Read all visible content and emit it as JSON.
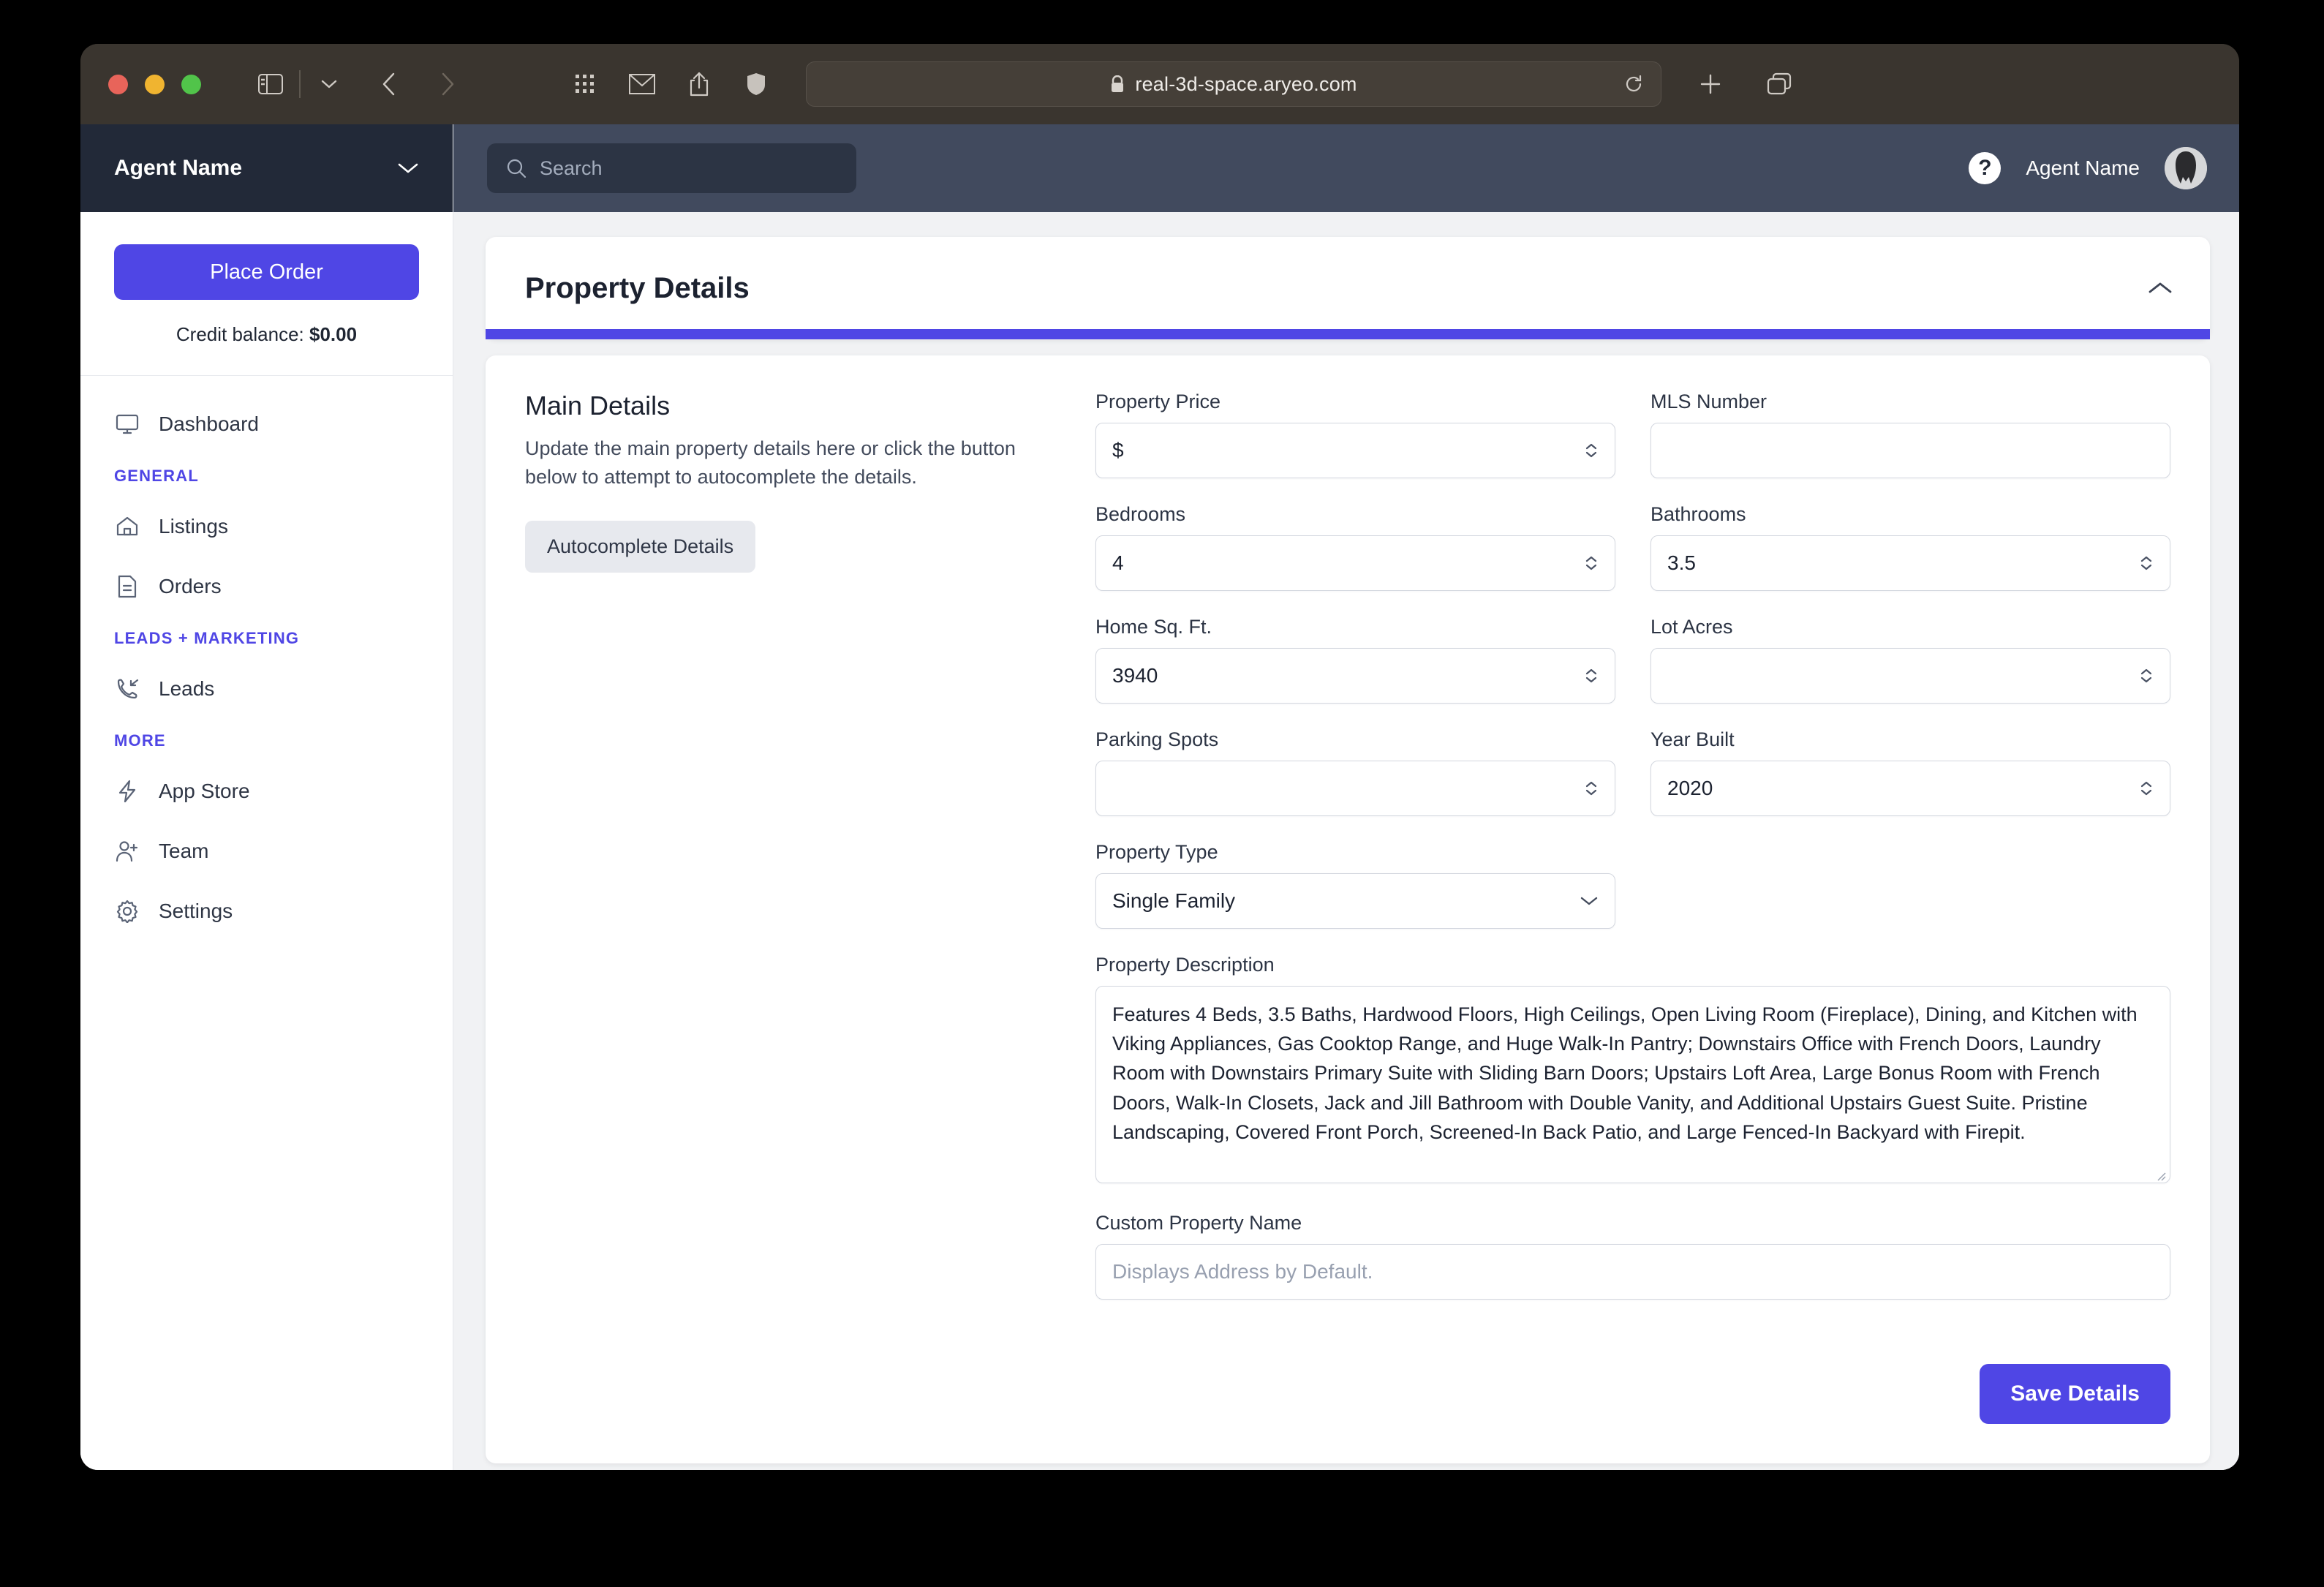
{
  "browser": {
    "url": "real-3d-space.aryeo.com",
    "icons": {
      "sidebar_toggle": "sidebar-toggle-icon",
      "sidebar_dropdown": "chevron-down-icon",
      "back": "back-arrow-icon",
      "forward": "forward-arrow-icon",
      "apps_grid": "apps-grid-icon",
      "mail": "mail-icon",
      "share": "share-icon",
      "privacy_shield": "shield-icon",
      "lock": "lock-icon",
      "reload": "reload-icon",
      "new_tab": "plus-icon",
      "tab_overview": "tab-overview-icon"
    }
  },
  "sidebar": {
    "org_name": "Agent Name",
    "org_caret": "chevron-down-icon",
    "place_order_label": "Place Order",
    "credit_label": "Credit balance:",
    "credit_value": "$0.00",
    "items": [
      {
        "label": "Dashboard",
        "icon": "monitor-icon"
      }
    ],
    "sections": [
      {
        "title": "GENERAL",
        "items": [
          {
            "label": "Listings",
            "icon": "home-icon"
          },
          {
            "label": "Orders",
            "icon": "document-icon"
          }
        ]
      },
      {
        "title": "LEADS + MARKETING",
        "items": [
          {
            "label": "Leads",
            "icon": "phone-incoming-icon"
          }
        ]
      },
      {
        "title": "MORE",
        "items": [
          {
            "label": "App Store",
            "icon": "lightning-icon"
          },
          {
            "label": "Team",
            "icon": "user-plus-icon"
          },
          {
            "label": "Settings",
            "icon": "gear-icon"
          }
        ]
      }
    ]
  },
  "topbar": {
    "search_placeholder": "Search",
    "search_value": "",
    "search_icon": "search-icon",
    "help_label": "?",
    "user_name": "Agent Name",
    "avatar_icon": "avatar"
  },
  "card": {
    "title": "Property Details",
    "collapse_icon": "chevron-up-icon",
    "accent_color": "#4f46e5"
  },
  "main_details": {
    "heading": "Main Details",
    "description": "Update the main property details here or click the button below to attempt to autocomplete the details.",
    "autocomplete_label": "Autocomplete Details"
  },
  "form": {
    "property_price": {
      "label": "Property Price",
      "value": "$",
      "spinner": true
    },
    "mls_number": {
      "label": "MLS Number",
      "value": "",
      "spinner": false
    },
    "bedrooms": {
      "label": "Bedrooms",
      "value": "4",
      "spinner": true
    },
    "bathrooms": {
      "label": "Bathrooms",
      "value": "3.5",
      "spinner": true
    },
    "home_sq_ft": {
      "label": "Home Sq. Ft.",
      "value": "3940",
      "spinner": true
    },
    "lot_acres": {
      "label": "Lot Acres",
      "value": "",
      "spinner": true
    },
    "parking_spots": {
      "label": "Parking Spots",
      "value": "",
      "spinner": true
    },
    "year_built": {
      "label": "Year Built",
      "value": "2020",
      "spinner": true
    },
    "property_type": {
      "label": "Property Type",
      "value": "Single Family",
      "arrow_icon": "chevron-down-icon"
    },
    "property_description": {
      "label": "Property Description",
      "value": "Features 4 Beds, 3.5 Baths, Hardwood Floors, High Ceilings, Open Living Room (Fireplace), Dining, and Kitchen with Viking Appliances, Gas Cooktop Range, and Huge Walk-In Pantry; Downstairs Office with French Doors, Laundry Room with Downstairs Primary Suite with Sliding Barn Doors; Upstairs Loft Area, Large Bonus Room with French Doors, Walk-In Closets, Jack and Jill Bathroom with Double Vanity, and Additional Upstairs Guest Suite. Pristine Landscaping, Covered Front Porch, Screened-In Back Patio, and Large Fenced-In Backyard with Firepit."
    },
    "custom_property_name": {
      "label": "Custom Property Name",
      "value": "",
      "placeholder": "Displays Address by Default."
    },
    "save_label": "Save Details"
  }
}
